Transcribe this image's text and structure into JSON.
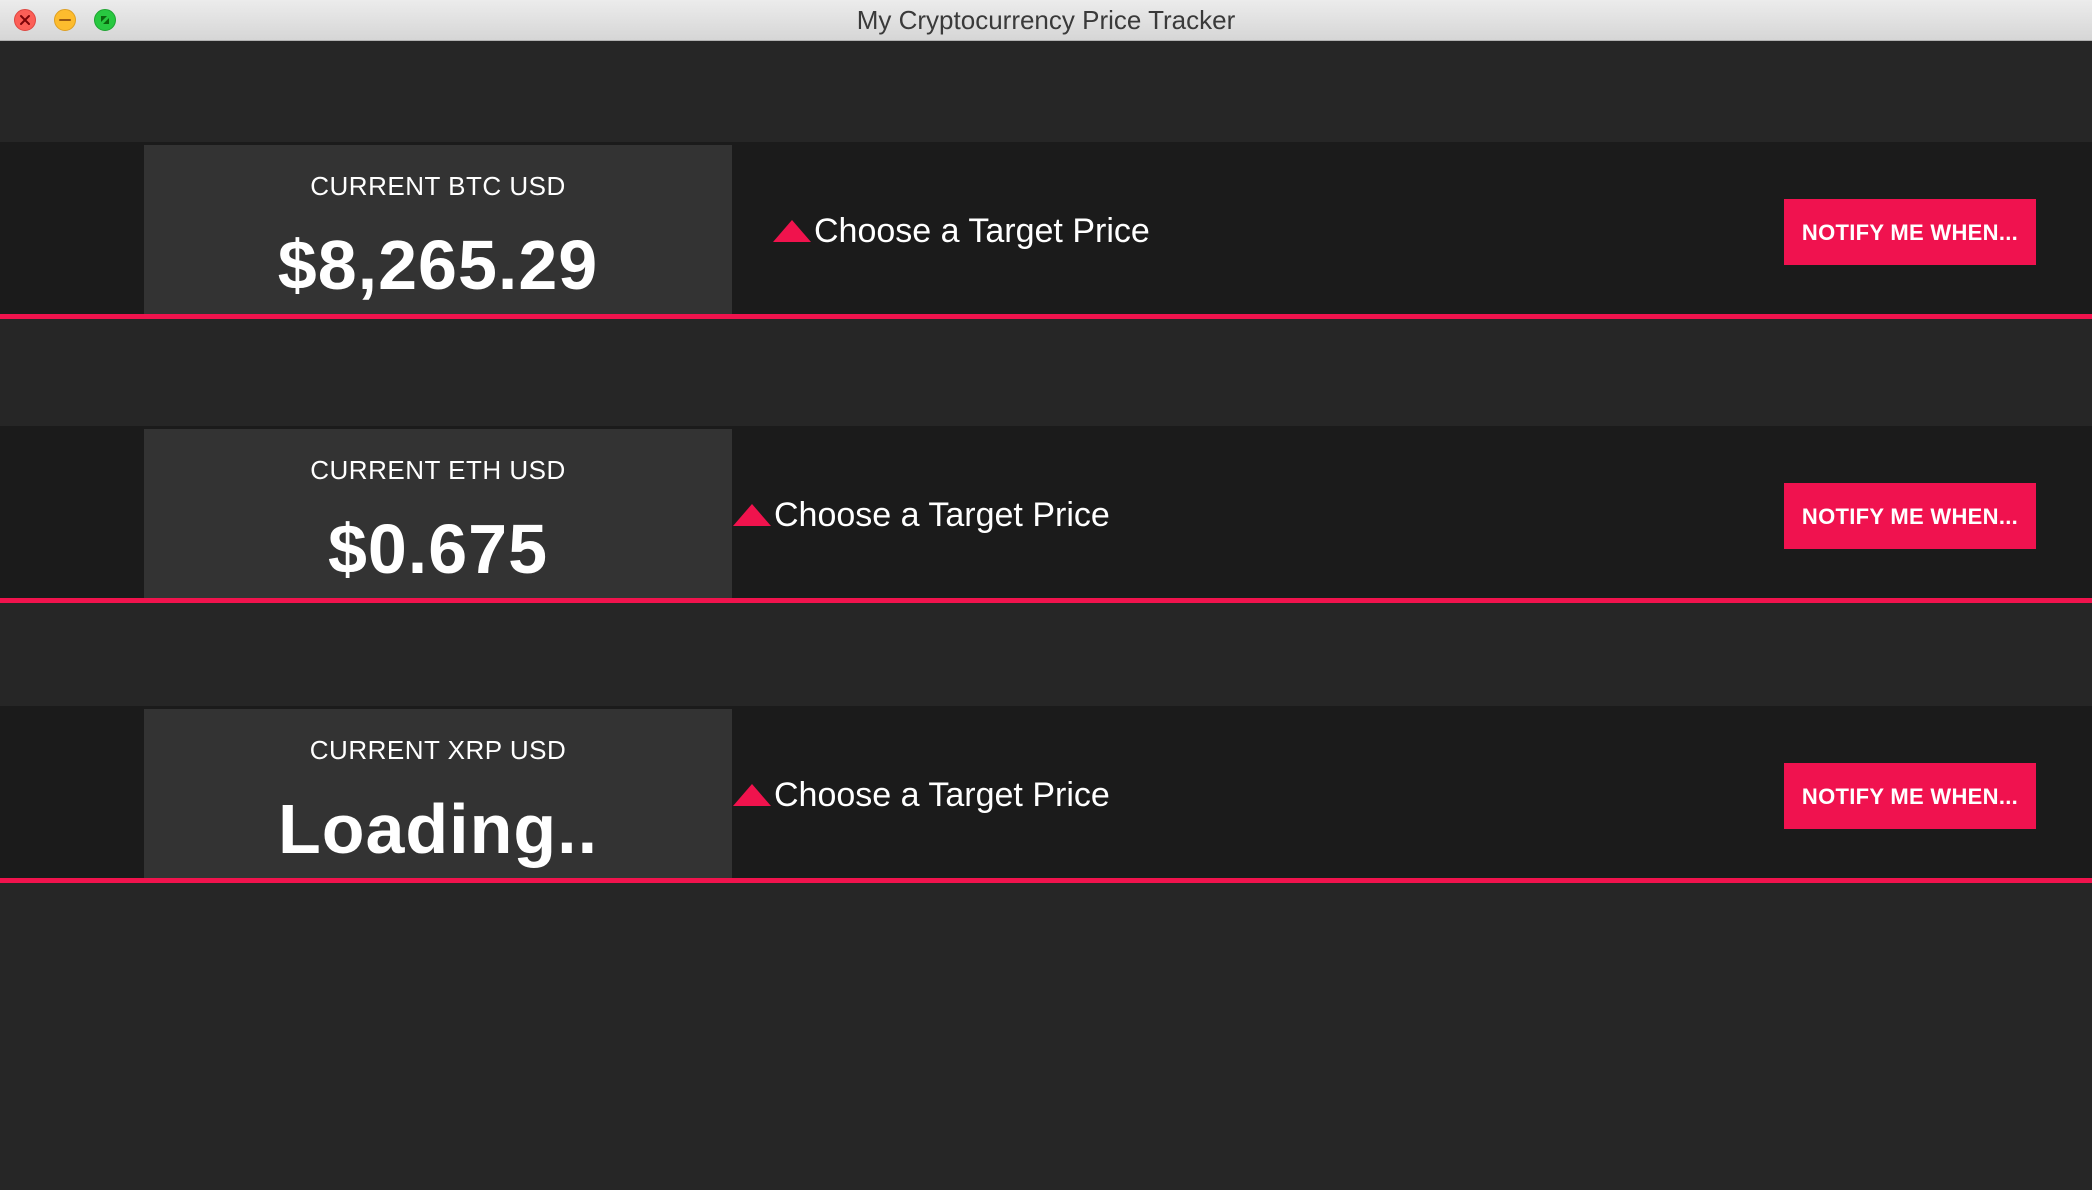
{
  "window": {
    "title": "My Cryptocurrency Price Tracker"
  },
  "colors": {
    "accent": "#f0134d",
    "background": "#262626",
    "row_background": "#1b1b1b",
    "price_box": "#333333",
    "text": "#ffffff"
  },
  "rows": [
    {
      "label": "CURRENT BTC USD",
      "price": "$8,265.29",
      "target_label": "Choose a Target Price",
      "button_label": "NOTIFY ME WHEN..."
    },
    {
      "label": "CURRENT ETH USD",
      "price": "$0.675",
      "target_label": "Choose a Target Price",
      "button_label": "NOTIFY ME WHEN..."
    },
    {
      "label": "CURRENT XRP USD",
      "price": "Loading..",
      "target_label": "Choose a Target Price",
      "button_label": "NOTIFY ME WHEN..."
    }
  ],
  "icons": {
    "close": "close-icon",
    "minimize": "minimize-icon",
    "maximize": "fullscreen-icon",
    "target": "triangle-up-icon"
  }
}
